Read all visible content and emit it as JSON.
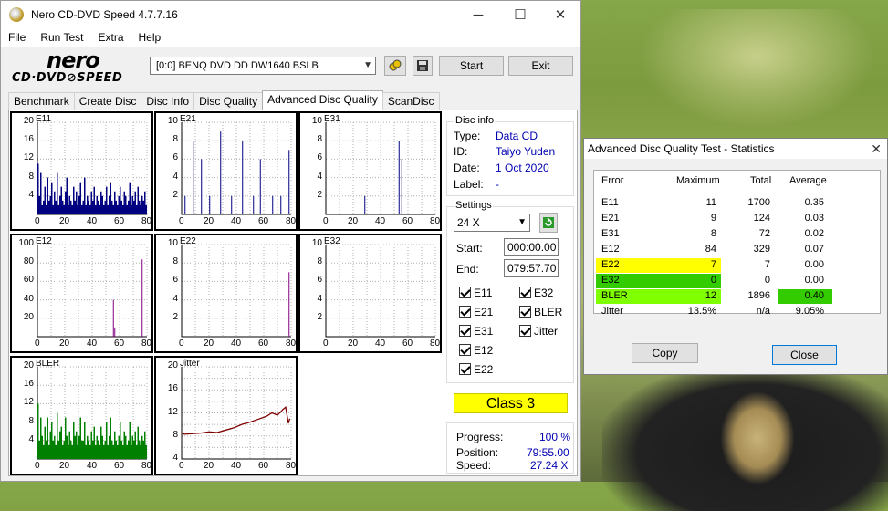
{
  "window": {
    "title": "Nero CD-DVD Speed 4.7.7.16",
    "minimize": "─",
    "maximize": "☐",
    "close": "✕"
  },
  "menu": [
    "File",
    "Run Test",
    "Extra",
    "Help"
  ],
  "logo": {
    "top": "nero",
    "bottom": "CD·DVD⊘SPEED"
  },
  "toolbar": {
    "drive": "[0:0]   BENQ DVD DD DW1640 BSLB",
    "start": "Start",
    "exit": "Exit"
  },
  "tabs": [
    "Benchmark",
    "Create Disc",
    "Disc Info",
    "Disc Quality",
    "Advanced Disc Quality",
    "ScanDisc"
  ],
  "active_tab": "Advanced Disc Quality",
  "chart_data": [
    {
      "type": "bar",
      "name": "E11",
      "xlim": [
        0,
        80
      ],
      "ylim": [
        0,
        20
      ],
      "y_ticks": [
        4,
        8,
        12,
        16,
        20
      ],
      "x_ticks": [
        0,
        20,
        40,
        60,
        80
      ],
      "color": "#000080",
      "values": [
        11,
        4,
        9,
        2,
        3,
        6,
        2,
        8,
        3,
        4,
        7,
        2,
        5,
        3,
        9,
        2,
        4,
        6,
        3,
        2,
        5,
        8,
        2,
        4,
        3,
        2,
        6,
        3,
        5,
        2,
        4,
        7,
        2,
        3,
        8,
        2,
        4,
        3,
        2,
        5,
        3,
        6,
        2,
        4,
        3,
        2,
        5,
        4,
        2,
        3,
        6,
        2,
        4,
        7,
        3,
        2,
        5,
        3,
        2,
        4,
        6,
        3,
        2,
        5,
        4,
        2,
        3,
        7,
        2,
        4,
        3,
        5,
        2,
        6,
        3,
        2,
        4,
        3,
        5,
        2
      ]
    },
    {
      "type": "bar",
      "name": "E21",
      "xlim": [
        0,
        80
      ],
      "ylim": [
        0,
        10
      ],
      "y_ticks": [
        2,
        4,
        6,
        8,
        10
      ],
      "x_ticks": [
        0,
        20,
        40,
        60,
        80
      ],
      "color": "#000080",
      "values": [
        {
          "x": 2,
          "y": 2
        },
        {
          "x": 8,
          "y": 8
        },
        {
          "x": 14,
          "y": 6
        },
        {
          "x": 20,
          "y": 2
        },
        {
          "x": 28,
          "y": 9
        },
        {
          "x": 36,
          "y": 2
        },
        {
          "x": 44,
          "y": 8
        },
        {
          "x": 52,
          "y": 2
        },
        {
          "x": 57,
          "y": 6
        },
        {
          "x": 66,
          "y": 2
        },
        {
          "x": 72,
          "y": 2
        },
        {
          "x": 78,
          "y": 7
        }
      ]
    },
    {
      "type": "bar",
      "name": "E31",
      "xlim": [
        0,
        80
      ],
      "ylim": [
        0,
        10
      ],
      "y_ticks": [
        2,
        4,
        6,
        8,
        10
      ],
      "x_ticks": [
        0,
        20,
        40,
        60,
        80
      ],
      "color": "#000080",
      "values": [
        {
          "x": 28,
          "y": 2
        },
        {
          "x": 53,
          "y": 8
        },
        {
          "x": 55,
          "y": 6
        }
      ]
    },
    {
      "type": "bar",
      "name": "E12",
      "xlim": [
        0,
        80
      ],
      "ylim": [
        0,
        100
      ],
      "y_ticks": [
        20,
        40,
        60,
        80,
        100
      ],
      "x_ticks": [
        0,
        20,
        40,
        60,
        80
      ],
      "color": "#800080",
      "values": [
        {
          "x": 55,
          "y": 40
        },
        {
          "x": 56,
          "y": 10
        },
        {
          "x": 76,
          "y": 84
        }
      ]
    },
    {
      "type": "bar",
      "name": "E22",
      "xlim": [
        0,
        80
      ],
      "ylim": [
        0,
        10
      ],
      "y_ticks": [
        2,
        4,
        6,
        8,
        10
      ],
      "x_ticks": [
        0,
        20,
        40,
        60,
        80
      ],
      "color": "#800080",
      "values": [
        {
          "x": 78,
          "y": 7
        }
      ]
    },
    {
      "type": "bar",
      "name": "E32",
      "xlim": [
        0,
        80
      ],
      "ylim": [
        0,
        10
      ],
      "y_ticks": [
        2,
        4,
        6,
        8,
        10
      ],
      "x_ticks": [
        0,
        20,
        40,
        60,
        80
      ],
      "color": "#800080",
      "values": []
    },
    {
      "type": "bar",
      "name": "BLER",
      "xlim": [
        0,
        80
      ],
      "ylim": [
        0,
        20
      ],
      "y_ticks": [
        4,
        8,
        12,
        16,
        20
      ],
      "x_ticks": [
        0,
        20,
        40,
        60,
        80
      ],
      "color": "#008000",
      "values": [
        12,
        4,
        9,
        5,
        3,
        7,
        4,
        9,
        3,
        6,
        8,
        4,
        5,
        3,
        10,
        4,
        6,
        7,
        3,
        4,
        9,
        5,
        3,
        6,
        4,
        3,
        8,
        5,
        6,
        3,
        5,
        9,
        4,
        4,
        8,
        3,
        5,
        4,
        3,
        6,
        4,
        7,
        3,
        5,
        4,
        3,
        7,
        5,
        3,
        4,
        8,
        3,
        5,
        9,
        4,
        3,
        6,
        4,
        3,
        5,
        8,
        4,
        3,
        6,
        5,
        3,
        4,
        8,
        3,
        5,
        4,
        6,
        3,
        7,
        4,
        3,
        5,
        4,
        6,
        3
      ]
    },
    {
      "type": "line",
      "name": "Jitter",
      "xlim": [
        0,
        80
      ],
      "ylim": [
        4,
        20
      ],
      "y_ticks": [
        4,
        6,
        8,
        10,
        12,
        14,
        16,
        18,
        20
      ],
      "x_ticks": [
        0,
        20,
        40,
        60,
        80
      ],
      "color": "#800000",
      "values": [
        {
          "x": 0,
          "y": 8.5
        },
        {
          "x": 2,
          "y": 8.3
        },
        {
          "x": 8,
          "y": 8.4
        },
        {
          "x": 14,
          "y": 8.5
        },
        {
          "x": 20,
          "y": 8.7
        },
        {
          "x": 26,
          "y": 8.6
        },
        {
          "x": 32,
          "y": 9.0
        },
        {
          "x": 38,
          "y": 9.4
        },
        {
          "x": 44,
          "y": 10.0
        },
        {
          "x": 50,
          "y": 10.4
        },
        {
          "x": 56,
          "y": 10.9
        },
        {
          "x": 62,
          "y": 11.4
        },
        {
          "x": 66,
          "y": 12.0
        },
        {
          "x": 70,
          "y": 11.6
        },
        {
          "x": 74,
          "y": 12.6
        },
        {
          "x": 76,
          "y": 13.0
        },
        {
          "x": 78,
          "y": 10.2
        },
        {
          "x": 79,
          "y": 11.0
        }
      ]
    }
  ],
  "disc_info": {
    "title": "Disc info",
    "type_label": "Type:",
    "type": "Data CD",
    "id_label": "ID:",
    "id": "Taiyo Yuden",
    "date_label": "Date:",
    "date": "1 Oct 2020",
    "label_label": "Label:",
    "label": "-"
  },
  "settings": {
    "title": "Settings",
    "speed": "24 X",
    "start_label": "Start:",
    "start": "000:00.00",
    "end_label": "End:",
    "end": "079:57.70",
    "checks_left": [
      "E11",
      "E21",
      "E31",
      "E12",
      "E22"
    ],
    "checks_right": [
      "E32",
      "BLER",
      "Jitter"
    ]
  },
  "class": "Class 3",
  "progress": {
    "progress_label": "Progress:",
    "progress": "100 %",
    "position_label": "Position:",
    "position": "79:55.00",
    "speed_label": "Speed:",
    "speed": "27.24 X"
  },
  "stats": {
    "title": "Advanced Disc Quality Test - Statistics",
    "close": "✕",
    "headers": [
      "Error",
      "Maximum",
      "Total",
      "Average"
    ],
    "rows": [
      {
        "name": "E11",
        "max": "11",
        "total": "1700",
        "avg": "0.35"
      },
      {
        "name": "E21",
        "max": "9",
        "total": "124",
        "avg": "0.03"
      },
      {
        "name": "E31",
        "max": "8",
        "total": "72",
        "avg": "0.02"
      },
      {
        "name": "E12",
        "max": "84",
        "total": "329",
        "avg": "0.07"
      },
      {
        "name": "E22",
        "max": "7",
        "total": "7",
        "avg": "0.00"
      },
      {
        "name": "E32",
        "max": "0",
        "total": "0",
        "avg": "0.00"
      },
      {
        "name": "BLER",
        "max": "12",
        "total": "1896",
        "avg": "0.40"
      },
      {
        "name": "Jitter",
        "max": "13.5%",
        "total": "n/a",
        "avg": "9.05%"
      }
    ],
    "highlight_yellow": "#ffff00",
    "highlight_green": "#33cc00",
    "highlight_lime": "#7fff00",
    "copy": "Copy",
    "close_btn": "Close"
  }
}
